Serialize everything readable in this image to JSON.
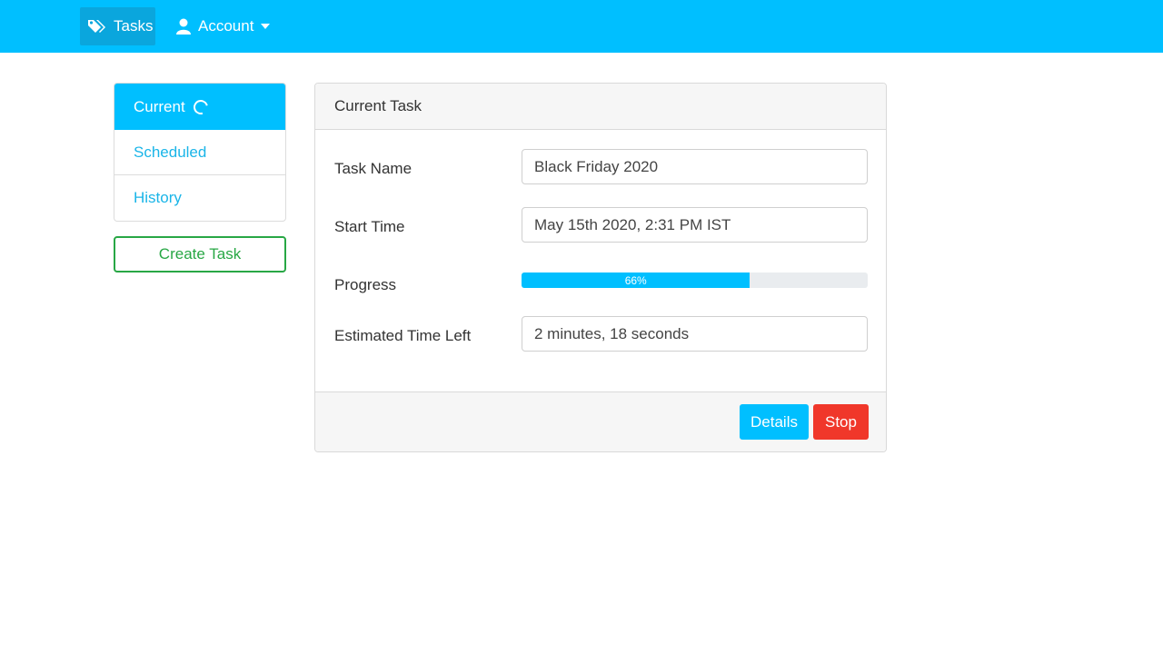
{
  "navbar": {
    "tasks_label": "Tasks",
    "tasks_icon": "tags-icon",
    "account_label": "Account",
    "account_icon": "user-icon",
    "bg_color": "#00bfff"
  },
  "sidebar": {
    "items": [
      {
        "label": "Current",
        "active": true,
        "icon": "spinner-icon"
      },
      {
        "label": "Scheduled",
        "active": false
      },
      {
        "label": "History",
        "active": false
      }
    ],
    "create_label": "Create Task"
  },
  "card": {
    "header": "Current Task",
    "fields": {
      "task_name_label": "Task Name",
      "task_name_value": "Black Friday 2020",
      "start_time_label": "Start Time",
      "start_time_value": "May 15th 2020, 2:31 PM IST",
      "progress_label": "Progress",
      "progress_text": "66%",
      "progress_value": 66,
      "eta_label": "Estimated Time Left",
      "eta_value": "2 minutes, 18 seconds"
    },
    "buttons": {
      "details": "Details",
      "stop": "Stop"
    }
  },
  "colors": {
    "accent": "#00bfff",
    "success": "#28a745",
    "danger": "#f0372a"
  }
}
